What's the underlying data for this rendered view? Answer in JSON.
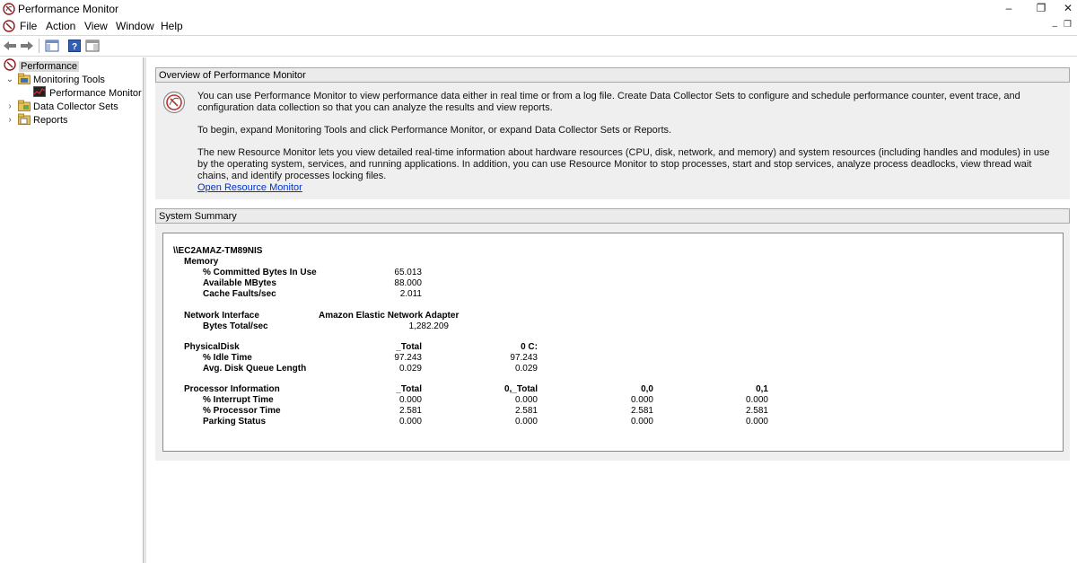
{
  "window": {
    "title": "Performance Monitor"
  },
  "menu": [
    "File",
    "Action",
    "View",
    "Window",
    "Help"
  ],
  "tree": {
    "root": "Performance",
    "monitoring_tools": "Monitoring Tools",
    "performance_monitor": "Performance Monitor",
    "data_collector_sets": "Data Collector Sets",
    "reports": "Reports"
  },
  "overview": {
    "header": "Overview of Performance Monitor",
    "paragraph1": "You can use Performance Monitor to view performance data either in real time or from a log file. Create Data Collector Sets to configure and schedule performance counter, event trace, and configuration data collection so that you can analyze the results and view reports.",
    "paragraph2": "To begin, expand Monitoring Tools and click Performance Monitor, or expand Data Collector Sets or Reports.",
    "paragraph3": "The new Resource Monitor lets you view detailed real-time information about hardware resources (CPU, disk, network, and memory) and system resources (including handles and modules) in use by the operating system, services, and running applications. In addition, you can use Resource Monitor to stop processes, start and stop services, analyze process deadlocks, view thread wait chains, and identify processes locking files.",
    "link": "Open Resource Monitor"
  },
  "summary": {
    "header": "System Summary",
    "machine": "\\\\EC2AMAZ-TM89NIS",
    "memory": {
      "title": "Memory",
      "rows": [
        {
          "label": "% Committed Bytes In Use",
          "value": "65.013"
        },
        {
          "label": "Available MBytes",
          "value": "88.000"
        },
        {
          "label": "Cache Faults/sec",
          "value": "2.011"
        }
      ]
    },
    "network": {
      "title": "Network Interface",
      "adapter": "Amazon Elastic Network Adapter",
      "rows": [
        {
          "label": "Bytes Total/sec",
          "value": "1,282.209"
        }
      ]
    },
    "disk": {
      "title": "PhysicalDisk",
      "columns": [
        "_Total",
        "0 C:"
      ],
      "rows": [
        {
          "label": "% Idle Time",
          "values": [
            "97.243",
            "97.243"
          ]
        },
        {
          "label": "Avg. Disk Queue Length",
          "values": [
            "0.029",
            "0.029"
          ]
        }
      ]
    },
    "processor": {
      "title": "Processor Information",
      "columns": [
        "_Total",
        "0,_Total",
        "0,0",
        "0,1"
      ],
      "rows": [
        {
          "label": "% Interrupt Time",
          "values": [
            "0.000",
            "0.000",
            "0.000",
            "0.000"
          ]
        },
        {
          "label": "% Processor Time",
          "values": [
            "2.581",
            "2.581",
            "2.581",
            "2.581"
          ]
        },
        {
          "label": "Parking Status",
          "values": [
            "0.000",
            "0.000",
            "0.000",
            "0.000"
          ]
        }
      ]
    }
  }
}
